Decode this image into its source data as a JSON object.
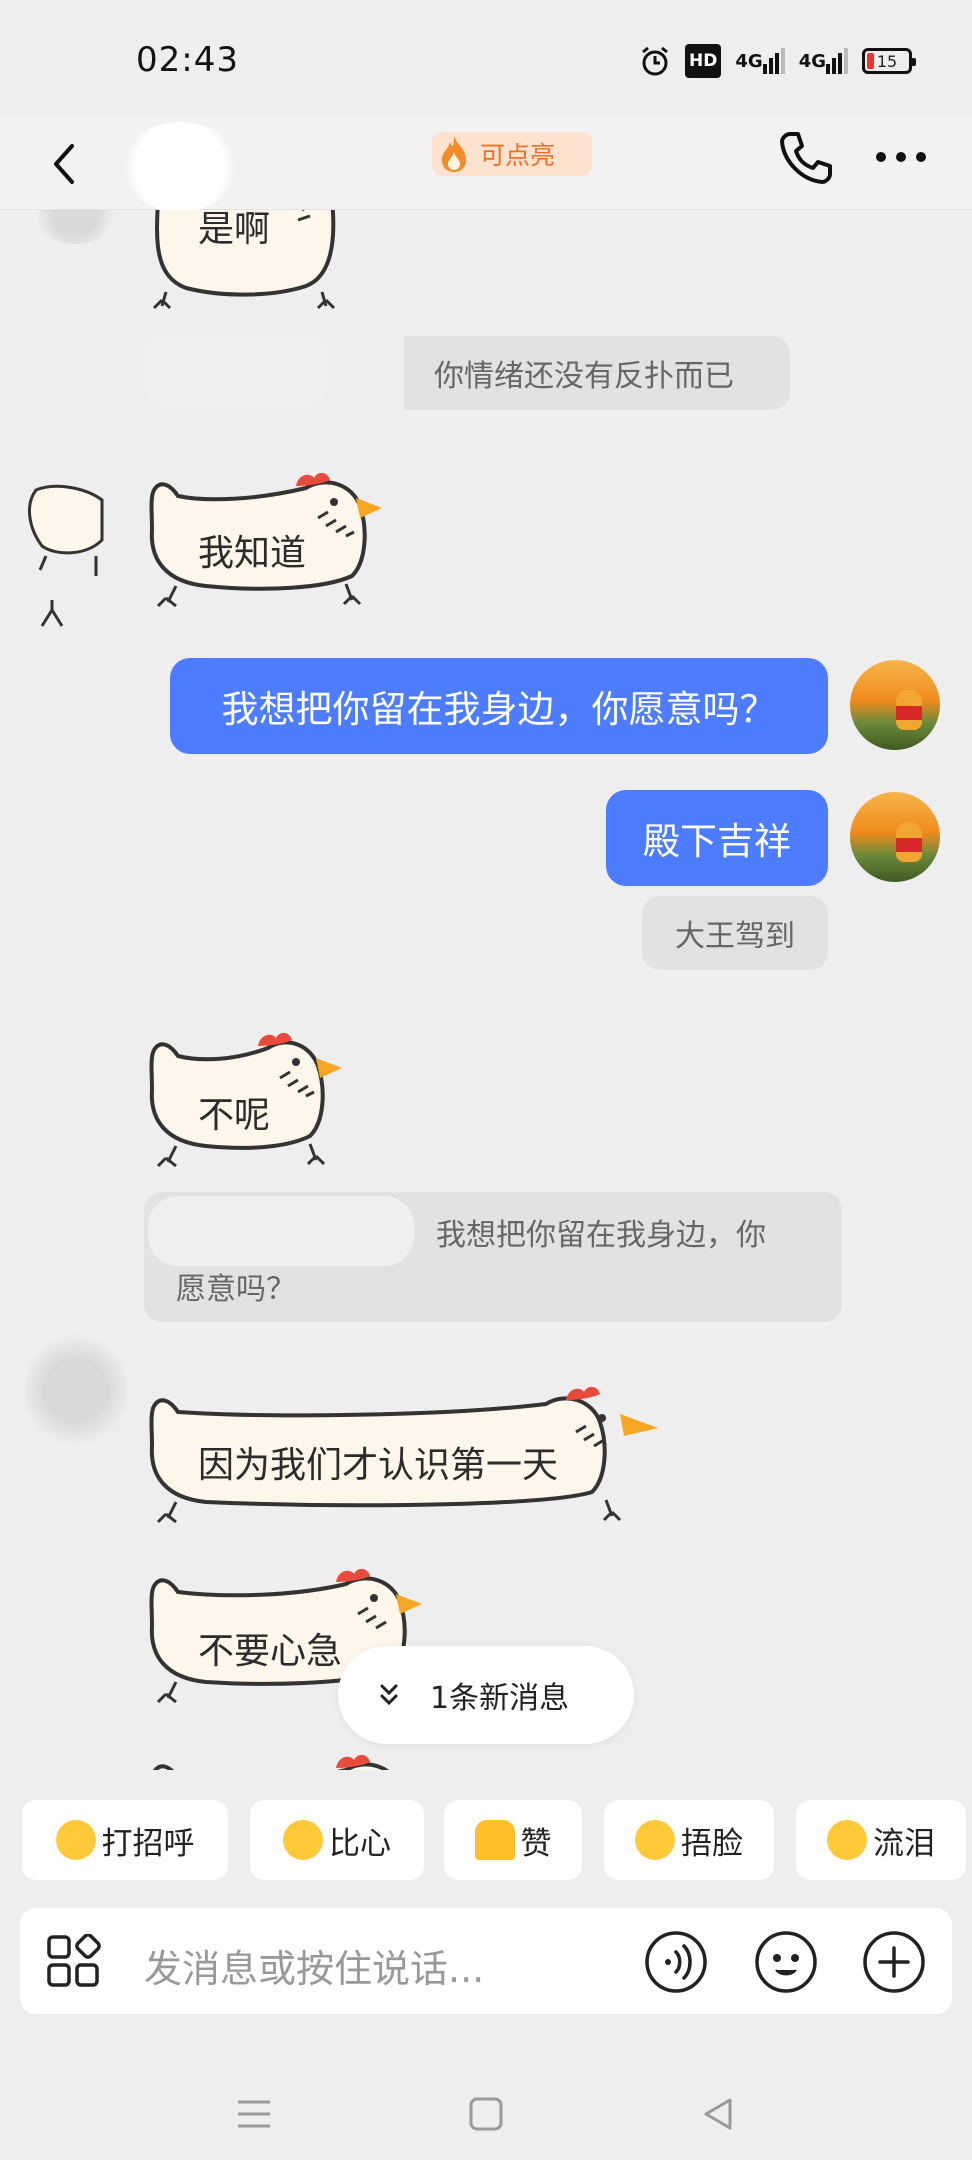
{
  "status_bar": {
    "time": "02:43",
    "hd_label": "HD",
    "signal1": "4G",
    "signal2": "4G",
    "battery": "15",
    "icons": [
      "alarm-icon",
      "hd-icon",
      "signal-icon",
      "battery-icon"
    ]
  },
  "header": {
    "badge_label": "可点亮",
    "icons": [
      "back-icon",
      "flame-icon",
      "phone-icon",
      "more-icon"
    ]
  },
  "messages": [
    {
      "side": "left",
      "type": "sticker",
      "text": "是啊"
    },
    {
      "side": "left",
      "type": "quote",
      "text": "你情绪还没有反扑而已"
    },
    {
      "side": "left",
      "type": "sticker",
      "text": "我知道"
    },
    {
      "side": "right",
      "type": "text",
      "text": "我想把你留在我身边，你愿意吗？"
    },
    {
      "side": "right",
      "type": "text",
      "text": "殿下吉祥"
    },
    {
      "side": "right",
      "type": "quote",
      "text": "大王驾到"
    },
    {
      "side": "left",
      "type": "sticker",
      "text": "不呢"
    },
    {
      "side": "left",
      "type": "quote",
      "text_line1": "我想把你留在我身边，你",
      "text_line2": "愿意吗？"
    },
    {
      "side": "left",
      "type": "sticker",
      "text": "因为我们才认识第一天"
    },
    {
      "side": "left",
      "type": "sticker",
      "text": "不要心急"
    }
  ],
  "new_messages": {
    "label": "1条新消息"
  },
  "quick_replies": [
    {
      "label": "打招呼",
      "icon": "wave-emoji-icon"
    },
    {
      "label": "比心",
      "icon": "heart-hands-emoji-icon"
    },
    {
      "label": "赞",
      "icon": "thumbs-up-emoji-icon"
    },
    {
      "label": "捂脸",
      "icon": "facepalm-emoji-icon"
    },
    {
      "label": "流泪",
      "icon": "crying-emoji-icon"
    }
  ],
  "input": {
    "placeholder": "发消息或按住说话...",
    "icons": [
      "apps-icon",
      "voice-icon",
      "emoji-icon",
      "plus-icon"
    ]
  },
  "nav": {
    "icons": [
      "menu-icon",
      "home-icon",
      "back-nav-icon"
    ]
  },
  "colors": {
    "accent_blue": "#4d7cfe",
    "badge_orange": "#f07026",
    "badge_bg": "#fde2cf",
    "background": "#eeeeee"
  }
}
